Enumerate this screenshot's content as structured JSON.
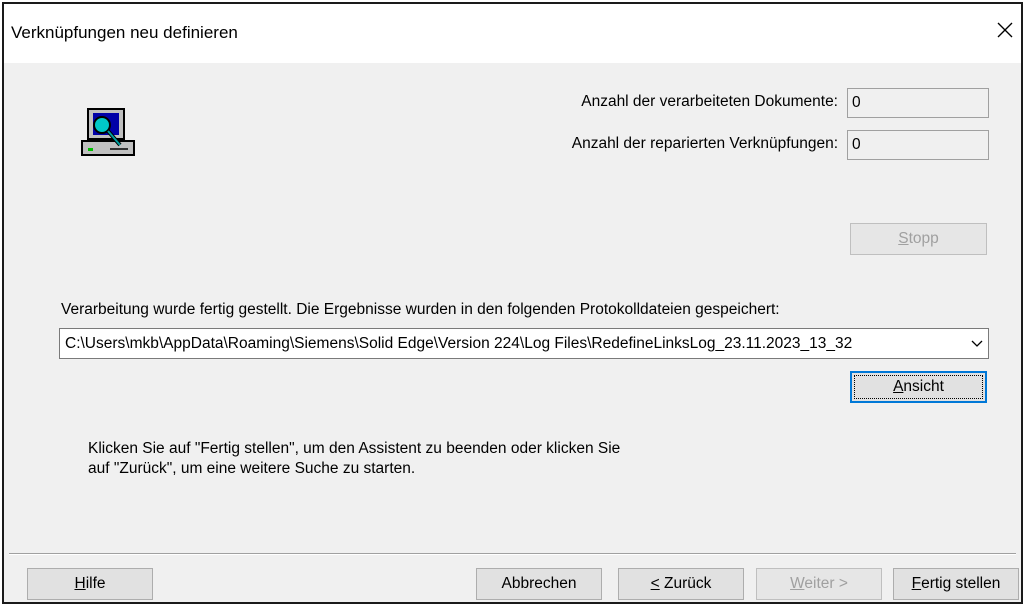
{
  "window": {
    "title": "Verknüpfungen neu definieren"
  },
  "icons": {
    "wizard": "computer-search-icon",
    "close": "close-icon",
    "dropdown": "chevron-down-icon"
  },
  "stats": {
    "processed_label": "Anzahl der verarbeiteten Dokumente:",
    "processed_value": "0",
    "repaired_label": "Anzahl der reparierten Verknüpfungen:",
    "repaired_value": "0"
  },
  "stop_button": {
    "label": "Stopp",
    "mnemonic": "S",
    "rest": "topp",
    "enabled": false
  },
  "result": {
    "message": "Verarbeitung wurde fertig gestellt. Die Ergebnisse wurden in den folgenden Protokolldateien gespeichert:",
    "log_path": "C:\\Users\\mkb\\AppData\\Roaming\\Siemens\\Solid Edge\\Version 224\\Log Files\\RedefineLinksLog_23.11.2023_13_32"
  },
  "view_button": {
    "label": "Ansicht",
    "mnemonic": "A",
    "rest": "nsicht"
  },
  "instructions": {
    "line1": "Klicken Sie auf \"Fertig stellen\", um den Assistent zu beenden oder klicken Sie",
    "line2": "auf \"Zurück\", um eine weitere Suche zu starten."
  },
  "footer": {
    "help": {
      "mnemonic": "H",
      "rest": "ilfe"
    },
    "cancel": "Abbrechen",
    "back": {
      "mnemonic": "<",
      "rest": " Zurück"
    },
    "next": {
      "mnemonic": "W",
      "rest": "eiter >",
      "enabled": false
    },
    "finish": {
      "mnemonic": "F",
      "rest": "ertig stellen"
    }
  }
}
